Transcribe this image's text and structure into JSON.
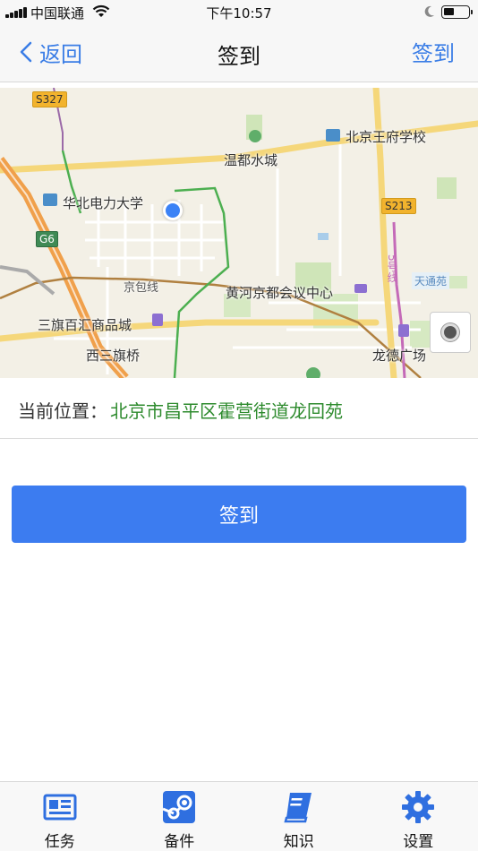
{
  "status_bar": {
    "carrier": "中国联通",
    "time": "下午10:57"
  },
  "nav": {
    "back_label": "返回",
    "title": "签到",
    "action_label": "签到"
  },
  "map": {
    "labels": {
      "s327": "S327",
      "g6": "G6",
      "s213": "S213",
      "school": "北京王府学校",
      "hotspring": "温都水城",
      "university": "华北电力大学",
      "jingbao": "京包线",
      "conference": "黄河京都会议中心",
      "mall": "三旗百汇商品城",
      "xisanqi": "西三旗桥",
      "tiantongyuan": "天通苑",
      "longde": "龙德广场",
      "line5": "5号线"
    }
  },
  "location": {
    "label": "当前位置：",
    "value": "北京市昌平区霍营街道龙回苑"
  },
  "checkin_button": "签到",
  "tabs": [
    {
      "label": "任务",
      "icon": "newspaper-icon"
    },
    {
      "label": "备件",
      "icon": "steam-icon"
    },
    {
      "label": "知识",
      "icon": "book-icon"
    },
    {
      "label": "设置",
      "icon": "gear-icon"
    }
  ],
  "colors": {
    "accent": "#3c7cf0",
    "nav_link": "#3a7de6",
    "location_text": "#2e8b2e",
    "tab_icon": "#2f6fe0"
  }
}
